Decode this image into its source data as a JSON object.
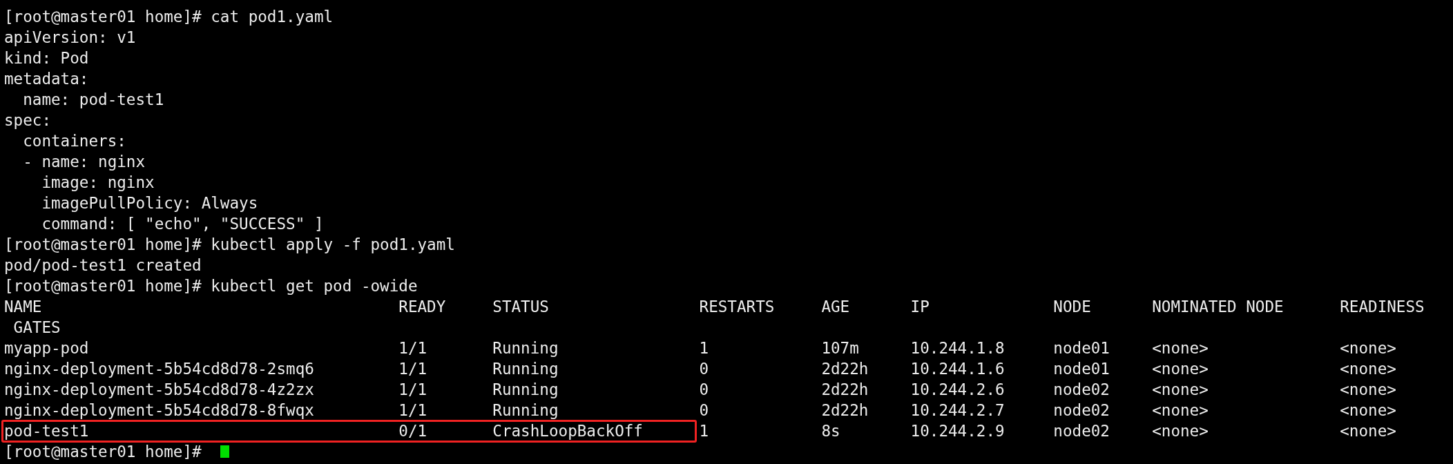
{
  "lines": [
    {
      "text": "[root@master01 home]# cat pod1.yaml"
    },
    {
      "text": "apiVersion: v1"
    },
    {
      "text": "kind: Pod"
    },
    {
      "text": "metadata:"
    },
    {
      "text": "  name: pod-test1"
    },
    {
      "text": "spec:"
    },
    {
      "text": "  containers:"
    },
    {
      "text": "  - name: nginx"
    },
    {
      "text": "    image: nginx"
    },
    {
      "text": "    imagePullPolicy: Always"
    },
    {
      "text": "    command: [ \"echo\", \"SUCCESS\" ]"
    },
    {
      "text": "[root@master01 home]# kubectl apply -f pod1.yaml"
    },
    {
      "text": "pod/pod-test1 created"
    },
    {
      "text": "[root@master01 home]# kubectl get pod -owide"
    }
  ],
  "table": {
    "columns": [
      "NAME",
      "READY",
      "STATUS",
      "RESTARTS",
      "AGE",
      "IP",
      "NODE",
      "NOMINATED NODE",
      "READINESS"
    ],
    "header_wrap": "GATES",
    "rows": [
      {
        "cells": [
          "myapp-pod",
          "1/1",
          "Running",
          "1",
          "107m",
          "10.244.1.8",
          "node01",
          "<none>",
          "<none>"
        ],
        "highlighted": false
      },
      {
        "cells": [
          "nginx-deployment-5b54cd8d78-2smq6",
          "1/1",
          "Running",
          "0",
          "2d22h",
          "10.244.1.6",
          "node01",
          "<none>",
          "<none>"
        ],
        "highlighted": false
      },
      {
        "cells": [
          "nginx-deployment-5b54cd8d78-4z2zx",
          "1/1",
          "Running",
          "0",
          "2d22h",
          "10.244.2.6",
          "node02",
          "<none>",
          "<none>"
        ],
        "highlighted": false
      },
      {
        "cells": [
          "nginx-deployment-5b54cd8d78-8fwqx",
          "1/1",
          "Running",
          "0",
          "2d22h",
          "10.244.2.7",
          "node02",
          "<none>",
          "<none>"
        ],
        "highlighted": false
      },
      {
        "cells": [
          "pod-test1",
          "0/1",
          "CrashLoopBackOff",
          "1",
          "8s",
          "10.244.2.9",
          "node02",
          "<none>",
          "<none>"
        ],
        "highlighted": true
      }
    ]
  },
  "prompt": {
    "text": "[root@master01 home]#"
  }
}
